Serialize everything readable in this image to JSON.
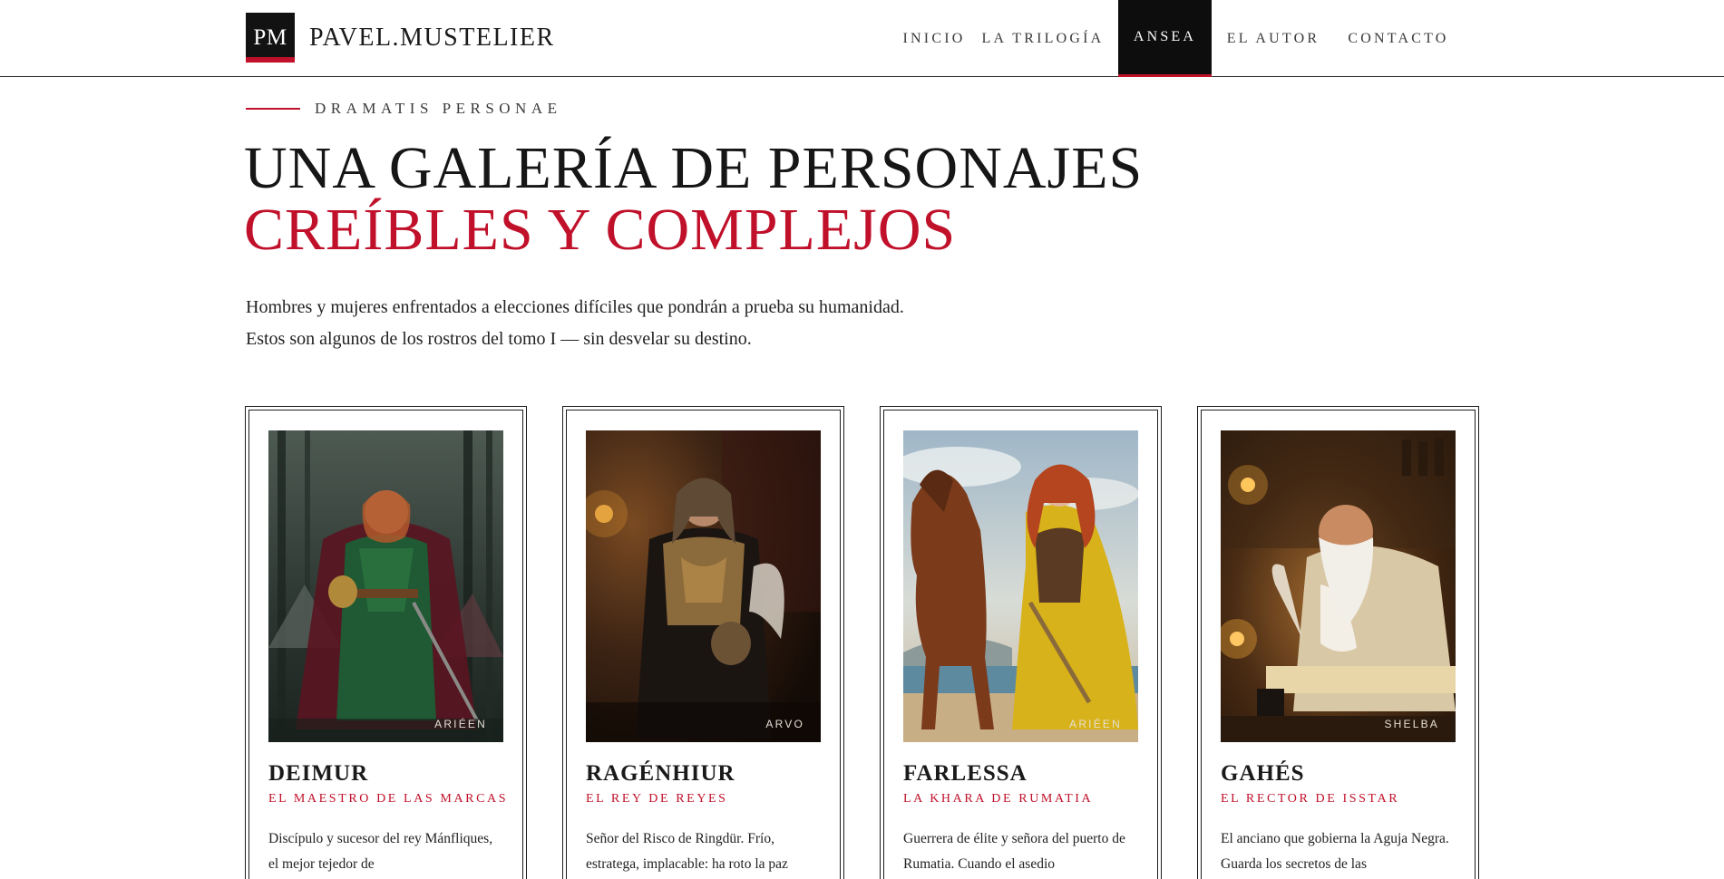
{
  "header": {
    "logo_mark": "PM",
    "logo_name": "PAVEL.MUSTELIER",
    "nav": [
      {
        "label": "INICIO",
        "active": false
      },
      {
        "label": "LA TRILOGÍA",
        "active": false
      },
      {
        "label": "ANSEA",
        "active": true
      },
      {
        "label": "EL AUTOR",
        "active": false
      },
      {
        "label": "CONTACTO",
        "active": false
      }
    ]
  },
  "intro": {
    "eyebrow": "DRAMATIS PERSONAE",
    "title_line1": "UNA GALERÍA DE PERSONAJES",
    "title_line2": "CREÍBLES Y COMPLEJOS",
    "lede_line1": "Hombres y mujeres enfrentados a elecciones difíciles que pondrán a prueba su humanidad.",
    "lede_line2": "Estos son algunos de los rostros del tomo I — sin desvelar su destino."
  },
  "colors": {
    "accent": "#c0102a",
    "ink": "#161616",
    "nav_active_bg": "#0d0d0d"
  },
  "cards": [
    {
      "artist": "ARIÉEN",
      "name": "DEIMUR",
      "role": "EL MAESTRO DE LAS MARCAS",
      "description": "Discípulo y sucesor del rey Mánfliques, el mejor tejedor de"
    },
    {
      "artist": "ARVO",
      "name": "RAGÉNHIUR",
      "role": "EL REY DE REYES",
      "description": "Señor del Risco de Ringdür. Frío, estratega, implacable: ha roto la paz"
    },
    {
      "artist": "ARIÉEN",
      "name": "FARLESSA",
      "role": "LA KHARA DE RUMATIA",
      "description": "Guerrera de élite y señora del puerto de Rumatia. Cuando el asedio"
    },
    {
      "artist": "SHELBA",
      "name": "GAHÉS",
      "role": "EL RECTOR DE ISSTAR",
      "description": "El anciano que gobierna la Aguja Negra. Guarda los secretos de las"
    }
  ]
}
